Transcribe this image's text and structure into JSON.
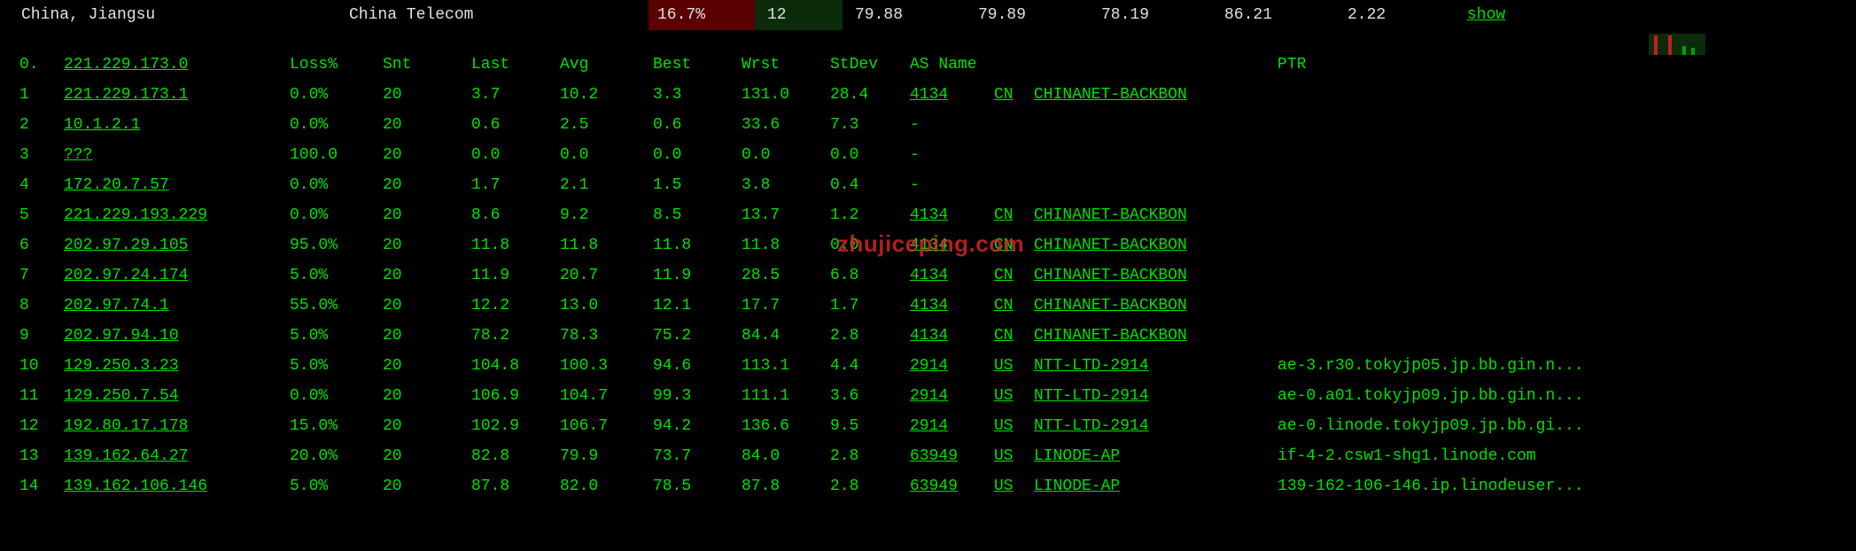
{
  "topbar": {
    "location": "China, Jiangsu",
    "isp": "China Telecom",
    "loss": "16.7%",
    "count": "12",
    "stats": [
      "79.88",
      "79.89",
      "78.19",
      "86.21",
      "2.22"
    ],
    "show_label": "show"
  },
  "headers": {
    "hop": "0.",
    "ip": "221.229.173.0",
    "loss": "Loss%",
    "snt": "Snt",
    "last": "Last",
    "avg": "Avg",
    "best": "Best",
    "wrst": "Wrst",
    "std": "StDev",
    "as_name": "AS Name",
    "ptr": "PTR"
  },
  "hops": [
    {
      "n": "1",
      "ip": "221.229.173.1",
      "loss": "0.0%",
      "snt": "20",
      "last": "3.7",
      "avg": "10.2",
      "best": "3.3",
      "wrst": "131.0",
      "std": "28.4",
      "as": "4134",
      "cc": "CN",
      "asn": "CHINANET-BACKBON",
      "ptr": ""
    },
    {
      "n": "2",
      "ip": "10.1.2.1",
      "loss": "0.0%",
      "snt": "20",
      "last": "0.6",
      "avg": "2.5",
      "best": "0.6",
      "wrst": "33.6",
      "std": "7.3",
      "as": "-",
      "cc": "",
      "asn": "",
      "ptr": ""
    },
    {
      "n": "3",
      "ip": "???",
      "loss": "100.0",
      "snt": "20",
      "last": "0.0",
      "avg": "0.0",
      "best": "0.0",
      "wrst": "0.0",
      "std": "0.0",
      "as": "-",
      "cc": "",
      "asn": "",
      "ptr": ""
    },
    {
      "n": "4",
      "ip": "172.20.7.57",
      "loss": "0.0%",
      "snt": "20",
      "last": "1.7",
      "avg": "2.1",
      "best": "1.5",
      "wrst": "3.8",
      "std": "0.4",
      "as": "-",
      "cc": "",
      "asn": "",
      "ptr": ""
    },
    {
      "n": "5",
      "ip": "221.229.193.229",
      "loss": "0.0%",
      "snt": "20",
      "last": "8.6",
      "avg": "9.2",
      "best": "8.5",
      "wrst": "13.7",
      "std": "1.2",
      "as": "4134",
      "cc": "CN",
      "asn": "CHINANET-BACKBON",
      "ptr": ""
    },
    {
      "n": "6",
      "ip": "202.97.29.105",
      "loss": "95.0%",
      "snt": "20",
      "last": "11.8",
      "avg": "11.8",
      "best": "11.8",
      "wrst": "11.8",
      "std": "0.0",
      "as": "4134",
      "cc": "CN",
      "asn": "CHINANET-BACKBON",
      "ptr": ""
    },
    {
      "n": "7",
      "ip": "202.97.24.174",
      "loss": "5.0%",
      "snt": "20",
      "last": "11.9",
      "avg": "20.7",
      "best": "11.9",
      "wrst": "28.5",
      "std": "6.8",
      "as": "4134",
      "cc": "CN",
      "asn": "CHINANET-BACKBON",
      "ptr": ""
    },
    {
      "n": "8",
      "ip": "202.97.74.1",
      "loss": "55.0%",
      "snt": "20",
      "last": "12.2",
      "avg": "13.0",
      "best": "12.1",
      "wrst": "17.7",
      "std": "1.7",
      "as": "4134",
      "cc": "CN",
      "asn": "CHINANET-BACKBON",
      "ptr": ""
    },
    {
      "n": "9",
      "ip": "202.97.94.10",
      "loss": "5.0%",
      "snt": "20",
      "last": "78.2",
      "avg": "78.3",
      "best": "75.2",
      "wrst": "84.4",
      "std": "2.8",
      "as": "4134",
      "cc": "CN",
      "asn": "CHINANET-BACKBON",
      "ptr": ""
    },
    {
      "n": "10",
      "ip": "129.250.3.23",
      "loss": "5.0%",
      "snt": "20",
      "last": "104.8",
      "avg": "100.3",
      "best": "94.6",
      "wrst": "113.1",
      "std": "4.4",
      "as": "2914",
      "cc": "US",
      "asn": "NTT-LTD-2914",
      "ptr": "ae-3.r30.tokyjp05.jp.bb.gin.n..."
    },
    {
      "n": "11",
      "ip": "129.250.7.54",
      "loss": "0.0%",
      "snt": "20",
      "last": "106.9",
      "avg": "104.7",
      "best": "99.3",
      "wrst": "111.1",
      "std": "3.6",
      "as": "2914",
      "cc": "US",
      "asn": "NTT-LTD-2914",
      "ptr": "ae-0.a01.tokyjp09.jp.bb.gin.n..."
    },
    {
      "n": "12",
      "ip": "192.80.17.178",
      "loss": "15.0%",
      "snt": "20",
      "last": "102.9",
      "avg": "106.7",
      "best": "94.2",
      "wrst": "136.6",
      "std": "9.5",
      "as": "2914",
      "cc": "US",
      "asn": "NTT-LTD-2914",
      "ptr": "ae-0.linode.tokyjp09.jp.bb.gi..."
    },
    {
      "n": "13",
      "ip": "139.162.64.27",
      "loss": "20.0%",
      "snt": "20",
      "last": "82.8",
      "avg": "79.9",
      "best": "73.7",
      "wrst": "84.0",
      "std": "2.8",
      "as": "63949",
      "cc": "US",
      "asn": "LINODE-AP",
      "ptr": "if-4-2.csw1-shg1.linode.com"
    },
    {
      "n": "14",
      "ip": "139.162.106.146",
      "loss": "5.0%",
      "snt": "20",
      "last": "87.8",
      "avg": "82.0",
      "best": "78.5",
      "wrst": "87.8",
      "std": "2.8",
      "as": "63949",
      "cc": "US",
      "asn": "LINODE-AP",
      "ptr": "139-162-106-146.ip.linodeuser..."
    }
  ],
  "watermark": "zhujiceping.com"
}
